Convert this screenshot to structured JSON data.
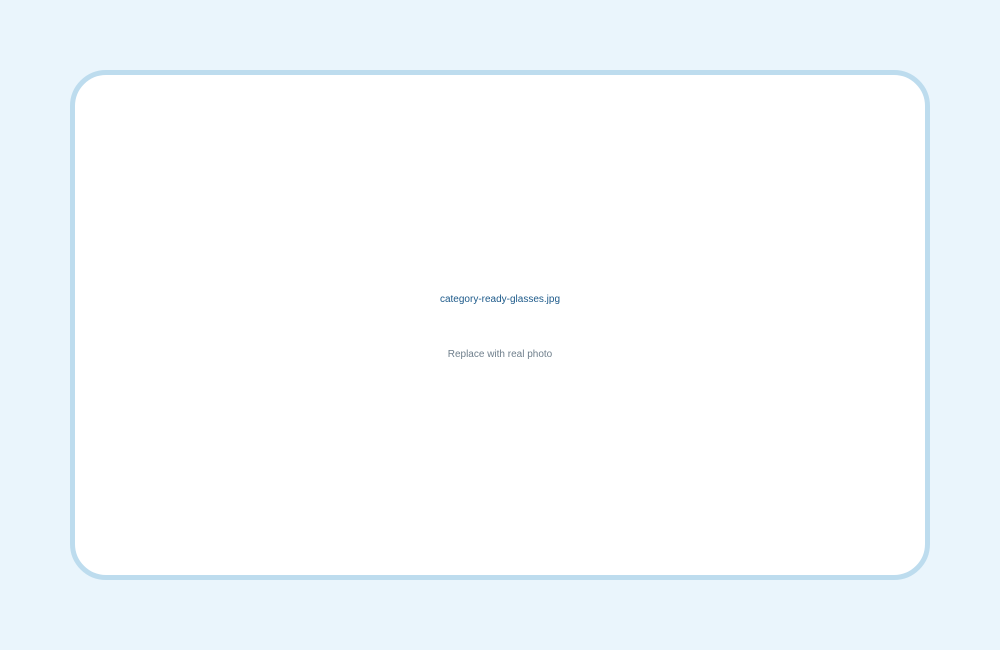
{
  "placeholder": {
    "filename": "category-ready-glasses.jpg",
    "hint": "Replace with real photo"
  },
  "colors": {
    "page_background": "#eaf5fc",
    "card_background": "#ffffff",
    "card_border": "#bddcee",
    "filename_text": "#1d5a8a",
    "hint_text": "#6f7f8c"
  }
}
